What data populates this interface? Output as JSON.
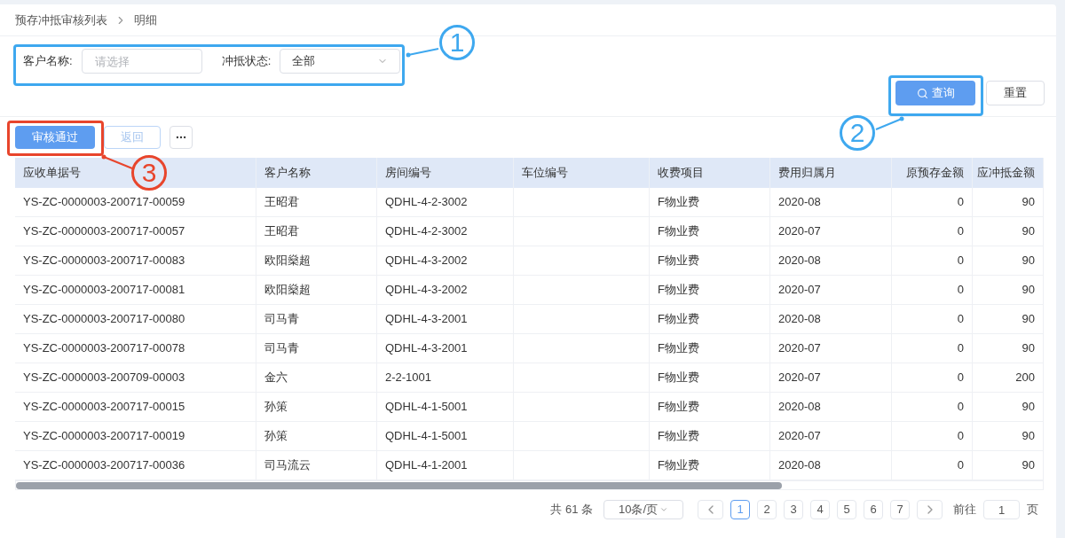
{
  "breadcrumb": [
    "预存冲抵审核列表",
    "明细"
  ],
  "filters": {
    "customer": {
      "label": "客户名称:",
      "placeholder": "请选择"
    },
    "status": {
      "label": "冲抵状态:",
      "value": "全部"
    }
  },
  "search_button": "查询",
  "reset_button": "重置",
  "toolbar": {
    "approve": "审核通过",
    "back": {
      "label": "返回",
      "disabled": true
    }
  },
  "table": {
    "columns": [
      "应收单据号",
      "客户名称",
      "房间编号",
      "车位编号",
      "收费项目",
      "费用归属月",
      "原预存金额",
      "应冲抵金额"
    ],
    "rows": [
      [
        "YS-ZC-0000003-200717-00059",
        "王昭君",
        "QDHL-4-2-3002",
        "",
        "F物业费",
        "2020-08",
        "0",
        "90"
      ],
      [
        "YS-ZC-0000003-200717-00057",
        "王昭君",
        "QDHL-4-2-3002",
        "",
        "F物业费",
        "2020-07",
        "0",
        "90"
      ],
      [
        "YS-ZC-0000003-200717-00083",
        "欧阳燊超",
        "QDHL-4-3-2002",
        "",
        "F物业费",
        "2020-08",
        "0",
        "90"
      ],
      [
        "YS-ZC-0000003-200717-00081",
        "欧阳燊超",
        "QDHL-4-3-2002",
        "",
        "F物业费",
        "2020-07",
        "0",
        "90"
      ],
      [
        "YS-ZC-0000003-200717-00080",
        "司马青",
        "QDHL-4-3-2001",
        "",
        "F物业费",
        "2020-08",
        "0",
        "90"
      ],
      [
        "YS-ZC-0000003-200717-00078",
        "司马青",
        "QDHL-4-3-2001",
        "",
        "F物业费",
        "2020-07",
        "0",
        "90"
      ],
      [
        "YS-ZC-0000003-200709-00003",
        "金六",
        "2-2-1001",
        "",
        "F物业费",
        "2020-07",
        "0",
        "200"
      ],
      [
        "YS-ZC-0000003-200717-00015",
        "孙策",
        "QDHL-4-1-5001",
        "",
        "F物业费",
        "2020-08",
        "0",
        "90"
      ],
      [
        "YS-ZC-0000003-200717-00019",
        "孙策",
        "QDHL-4-1-5001",
        "",
        "F物业费",
        "2020-07",
        "0",
        "90"
      ],
      [
        "YS-ZC-0000003-200717-00036",
        "司马流云",
        "QDHL-4-1-2001",
        "",
        "F物业费",
        "2020-08",
        "0",
        "90"
      ]
    ]
  },
  "pagination": {
    "total": "共 61 条",
    "page_size": "10条/页",
    "pages": [
      {
        "label": "1",
        "selected": true
      },
      {
        "label": "2",
        "selected": false
      },
      {
        "label": "3",
        "selected": false
      },
      {
        "label": "4",
        "selected": false
      },
      {
        "label": "5",
        "selected": false
      },
      {
        "label": "6",
        "selected": false
      },
      {
        "label": "7",
        "selected": false
      }
    ],
    "goto_label": "前往",
    "goto_value": "1",
    "goto_suffix": "页"
  },
  "annotations": [
    {
      "label": "1",
      "color": "#3ea8ef"
    },
    {
      "label": "2",
      "color": "#3ea8ef"
    },
    {
      "label": "3",
      "color": "#e8452c"
    }
  ]
}
